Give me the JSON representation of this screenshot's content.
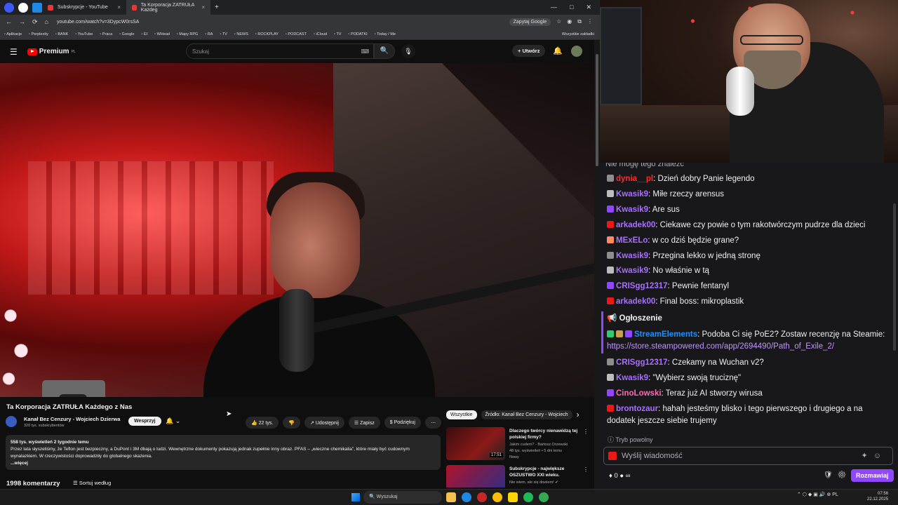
{
  "browser": {
    "tabs": [
      {
        "label": "Subskrypcje - YouTube",
        "close": "×"
      },
      {
        "label": "Ta Korporacja ZATRUŁA Każdeg",
        "close": "×"
      }
    ],
    "new_tab": "+",
    "window_controls": [
      "—",
      "□",
      "✕"
    ],
    "nav": [
      "←",
      "→",
      "⟳",
      "⌂"
    ],
    "url": "youtube.com/watch?v=3DypcW0rsSA",
    "ask_button": "Zapytaj Google",
    "bookmarks": [
      "Aplikacje",
      "Perplexity",
      "BANK",
      "YouTube",
      "Praca",
      "Google",
      "EI",
      "WHead",
      "Mapy RPG",
      "RA",
      "TV",
      "NEWS",
      "ROCKPLAY",
      "PODCAST",
      "iCloud",
      "TV",
      "PODATKI",
      "Today / Me"
    ],
    "bookmarks_right": "Wszystkie zakładki"
  },
  "youtube": {
    "menu_icon": "☰",
    "logo_text": "Premium",
    "logo_sup": "PL",
    "search_placeholder": "Szukaj",
    "keyboard_icon": "⌨",
    "search_icon": "🔍",
    "mic_icon": "🎙",
    "create_label": "+ Utwórz",
    "bell_icon": "🔔",
    "video_title": "Ta Korporacja ZATRUŁA Każdego z Nas",
    "channel_name": "Kanał Bez Cenzury - Wojciech Dzierwa",
    "subscribers": "320 tys. subskrybentów",
    "support_label": "Wesprzyj",
    "bell_sub": "🔔 ⌄",
    "actions": {
      "likes": "👍 22 tys.",
      "dislike": "👎",
      "share": "↗ Udostępnij",
      "save": "☰ Zapisz",
      "thanks": "$ Podziękuj",
      "more": "⋯"
    },
    "description": {
      "meta": "558 tys. wyświetleń  2 tygodnie temu",
      "text": "Przez lata słyszeliśmy, że Teflon jest bezpieczny, a DuPont i 3M dbają o ludzi. Wewnętrzne dokumenty pokazują jednak zupełnie inny obraz. PFAS – „wieczne chemikalia”, które miały być cudownym wynalazkiem. W rzeczywistości doprowadziły do globalnego skażenia.",
      "more": "...więcej"
    },
    "comments_count": "1998 komentarzy",
    "sort_label": "☰ Sortuj według",
    "chips": [
      "Wszystkie",
      "Źródło: Kanał Bez Cenzury - Wojciech"
    ],
    "chips_next": "›",
    "recommendations": [
      {
        "title": "Dlaczego twórcy nienawidzą tej polskiej firmy?",
        "meta1": "Jakim cudem? - Bartosz Orzewski",
        "meta2": "48 tys. wyświetleń • 5 dni temu",
        "meta3": "Nowy",
        "duration": "17:51",
        "dots": "⋮"
      },
      {
        "title": "Subskrypcje - największe OSZUSTWO XXI wieku.",
        "meta1": "Nie wiem, ale się dowiem! ✔",
        "meta2": "",
        "meta3": "",
        "duration": "",
        "dots": "⋮"
      }
    ]
  },
  "taskbar": {
    "search_label": "🔍 Wyszukaj",
    "tray": "⌃  ⬡  ◆  ▣  🔊  ⊕  PL",
    "time": "07:56",
    "date": "22.12.2025"
  },
  "chat": {
    "cut_top": "Nie mogę tego znaleźć",
    "messages": [
      {
        "user": "dynia__pl",
        "color": "#ff2a2a",
        "text": ": Dzień dobry Panie legendo"
      },
      {
        "user": "Kwasik9",
        "color": "#a970ff",
        "text": ": Miłe rzeczy arensus"
      },
      {
        "user": "Kwasik9",
        "color": "#a970ff",
        "text": ": Are sus"
      },
      {
        "user": "arkadek00",
        "color": "#a970ff",
        "text": ": Ciekawe czy powie o tym rakotwórczym pudrze dla dzieci"
      },
      {
        "user": "MExELo",
        "color": "#a970ff",
        "text": ": w co dziś będzie grane?"
      },
      {
        "user": "Kwasik9",
        "color": "#a970ff",
        "text": ": Przegina lekko w jedną stronę"
      },
      {
        "user": "Kwasik9",
        "color": "#a970ff",
        "text": ": No właśnie w tą"
      },
      {
        "user": "CRISgg12317",
        "color": "#a970ff",
        "text": ": Pewnie fentanyl"
      },
      {
        "user": "arkadek00",
        "color": "#a970ff",
        "text": ": Final boss: mikroplastik"
      }
    ],
    "announcement": {
      "title": "📢 Ogłoszenie",
      "user": "StreamElements",
      "text": ": Podoba Ci się PoE2? Zostaw recenzję na Steamie: ",
      "link": "https://store.steampowered.com/app/2694490/Path_of_Exile_2/"
    },
    "messages_after": [
      {
        "user": "CRISgg12317",
        "color": "#a970ff",
        "text": ": Czekamy na Wuchan v2?"
      },
      {
        "user": "Kwasik9",
        "color": "#a970ff",
        "text": ": \"Wybierz swoją truciznę\""
      },
      {
        "user": "CinoLowski",
        "color": "#ff69b4",
        "text": ": Teraz już AI stworzy wirusa"
      },
      {
        "user": "brontozaur",
        "color": "#a970ff",
        "text": ": hahah jesteśmy blisko i tego pierwszego i drugiego a na dodatek jeszcze siebie trujemy"
      }
    ],
    "slow_mode": "ⓘ  Tryb powolny",
    "input_placeholder": "Wyślij wiadomość",
    "input_icons": "✦☺",
    "points": "♦ 0  ● ∞",
    "bottom_icons": "🛡⚙",
    "send_label": "Rozmawiaj"
  }
}
